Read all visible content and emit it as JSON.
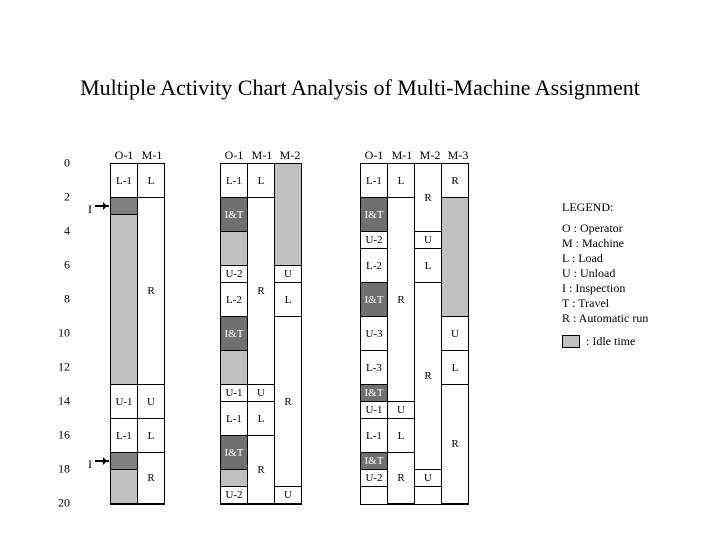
{
  "title": "Multiple Activity Chart Analysis of Multi-Machine Assignment",
  "legend_title": "LEGEND:",
  "legend": {
    "O": "O : Operator",
    "M": "M : Machine",
    "L": "L :  Load",
    "U": "U : Unload",
    "I": "I :   Inspection",
    "T": "T :  Travel",
    "R": "R : Automatic run",
    "idle": ": Idle time"
  },
  "yticks": [
    "0",
    "2",
    "4",
    "6",
    "8",
    "10",
    "12",
    "14",
    "16",
    "18",
    "20"
  ],
  "I_label": "I",
  "groups": {
    "g1": {
      "h": [
        "O-1",
        "M-1"
      ]
    },
    "g2": {
      "h": [
        "O-1",
        "M-1",
        "M-2"
      ]
    },
    "g3": {
      "h": [
        "O-1",
        "M-1",
        "M-2",
        "M-3"
      ]
    }
  },
  "labels": {
    "L1": "L-1",
    "L": "L",
    "IT": "I&T",
    "R": "R",
    "U1": "U-1",
    "U": "U",
    "U2": "U-2",
    "L2": "L-2",
    "U3": "U-3",
    "L3": "L-3"
  },
  "chart_data": {
    "type": "gantt-multiactivity",
    "time_axis": {
      "start": 0,
      "end": 20,
      "step": 2
    },
    "legend_codes": {
      "O": "Operator",
      "M": "Machine",
      "L": "Load",
      "U": "Unload",
      "I": "Inspection",
      "T": "Travel",
      "R": "Automatic run",
      "idle": "Idle time"
    },
    "groups": [
      {
        "id": 1,
        "columns": [
          "O-1",
          "M-1"
        ],
        "bars": {
          "O-1": [
            {
              "from": 0,
              "to": 2,
              "label": "L-1",
              "code": "L"
            },
            {
              "from": 2,
              "to": 3,
              "label": "I",
              "code": "I"
            },
            {
              "from": 3,
              "to": 13,
              "label": "",
              "code": "idle"
            },
            {
              "from": 13,
              "to": 15,
              "label": "U-1",
              "code": "U"
            },
            {
              "from": 15,
              "to": 17,
              "label": "L-1",
              "code": "L"
            },
            {
              "from": 17,
              "to": 18,
              "label": "I",
              "code": "I"
            },
            {
              "from": 18,
              "to": 20,
              "label": "",
              "code": "idle"
            }
          ],
          "M-1": [
            {
              "from": 0,
              "to": 2,
              "label": "L",
              "code": "L"
            },
            {
              "from": 2,
              "to": 13,
              "label": "R",
              "code": "R"
            },
            {
              "from": 13,
              "to": 15,
              "label": "U",
              "code": "U"
            },
            {
              "from": 15,
              "to": 17,
              "label": "L",
              "code": "L"
            },
            {
              "from": 17,
              "to": 20,
              "label": "R",
              "code": "R"
            }
          ]
        }
      },
      {
        "id": 2,
        "columns": [
          "O-1",
          "M-1",
          "M-2"
        ],
        "bars": {
          "O-1": [
            {
              "from": 0,
              "to": 2,
              "label": "L-1",
              "code": "L"
            },
            {
              "from": 2,
              "to": 4,
              "label": "I&T",
              "code": "IT"
            },
            {
              "from": 4,
              "to": 6,
              "label": "",
              "code": "idle"
            },
            {
              "from": 6,
              "to": 7,
              "label": "U-2",
              "code": "U"
            },
            {
              "from": 7,
              "to": 9,
              "label": "L-2",
              "code": "L"
            },
            {
              "from": 9,
              "to": 11,
              "label": "I&T",
              "code": "IT"
            },
            {
              "from": 11,
              "to": 13,
              "label": "",
              "code": "idle"
            },
            {
              "from": 13,
              "to": 14,
              "label": "U-1",
              "code": "U"
            },
            {
              "from": 14,
              "to": 16,
              "label": "L-1",
              "code": "L"
            },
            {
              "from": 16,
              "to": 18,
              "label": "I&T",
              "code": "IT"
            },
            {
              "from": 18,
              "to": 19,
              "label": "",
              "code": "idle"
            },
            {
              "from": 19,
              "to": 20,
              "label": "U-2",
              "code": "U"
            }
          ],
          "M-1": [
            {
              "from": 0,
              "to": 2,
              "label": "L",
              "code": "L"
            },
            {
              "from": 2,
              "to": 13,
              "label": "R",
              "code": "R"
            },
            {
              "from": 13,
              "to": 14,
              "label": "U",
              "code": "U"
            },
            {
              "from": 14,
              "to": 16,
              "label": "L",
              "code": "L"
            },
            {
              "from": 16,
              "to": 20,
              "label": "R",
              "code": "R"
            }
          ],
          "M-2": [
            {
              "from": 0,
              "to": 6,
              "label": "",
              "code": "idle"
            },
            {
              "from": 6,
              "to": 7,
              "label": "U",
              "code": "U"
            },
            {
              "from": 7,
              "to": 9,
              "label": "L",
              "code": "L"
            },
            {
              "from": 9,
              "to": 19,
              "label": "R",
              "code": "R"
            },
            {
              "from": 19,
              "to": 20,
              "label": "U",
              "code": "U"
            }
          ]
        }
      },
      {
        "id": 3,
        "columns": [
          "O-1",
          "M-1",
          "M-2",
          "M-3"
        ],
        "bars": {
          "O-1": [
            {
              "from": 0,
              "to": 2,
              "label": "L-1",
              "code": "L"
            },
            {
              "from": 2,
              "to": 4,
              "label": "I&T",
              "code": "IT"
            },
            {
              "from": 4,
              "to": 5,
              "label": "U-2",
              "code": "U"
            },
            {
              "from": 5,
              "to": 7,
              "label": "L-2",
              "code": "L"
            },
            {
              "from": 7,
              "to": 9,
              "label": "I&T",
              "code": "IT"
            },
            {
              "from": 9,
              "to": 11,
              "label": "U-3",
              "code": "U"
            },
            {
              "from": 11,
              "to": 13,
              "label": "L-3",
              "code": "L"
            },
            {
              "from": 13,
              "to": 14,
              "label": "I&T",
              "code": "IT"
            },
            {
              "from": 14,
              "to": 15,
              "label": "U-1",
              "code": "U"
            },
            {
              "from": 15,
              "to": 17,
              "label": "L-1",
              "code": "L"
            },
            {
              "from": 17,
              "to": 18,
              "label": "I&T",
              "code": "IT"
            },
            {
              "from": 18,
              "to": 19,
              "label": "U-2",
              "code": "U"
            }
          ],
          "M-1": [
            {
              "from": 0,
              "to": 2,
              "label": "L",
              "code": "L"
            },
            {
              "from": 2,
              "to": 14,
              "label": "R",
              "code": "R"
            },
            {
              "from": 14,
              "to": 15,
              "label": "U",
              "code": "U"
            },
            {
              "from": 15,
              "to": 17,
              "label": "L",
              "code": "L"
            },
            {
              "from": 17,
              "to": 20,
              "label": "R",
              "code": "R"
            }
          ],
          "M-2": [
            {
              "from": 0,
              "to": 4,
              "label": "R",
              "code": "R"
            },
            {
              "from": 4,
              "to": 5,
              "label": "U",
              "code": "U"
            },
            {
              "from": 5,
              "to": 7,
              "label": "L",
              "code": "L"
            },
            {
              "from": 7,
              "to": 18,
              "label": "R",
              "code": "R"
            },
            {
              "from": 18,
              "to": 19,
              "label": "U",
              "code": "U"
            }
          ],
          "M-3": [
            {
              "from": 0,
              "to": 2,
              "label": "R",
              "code": "R"
            },
            {
              "from": 2,
              "to": 9,
              "label": "",
              "code": "idle"
            },
            {
              "from": 9,
              "to": 11,
              "label": "U",
              "code": "U"
            },
            {
              "from": 11,
              "to": 13,
              "label": "L",
              "code": "L"
            },
            {
              "from": 13,
              "to": 20,
              "label": "R",
              "code": "R"
            }
          ]
        }
      }
    ]
  }
}
